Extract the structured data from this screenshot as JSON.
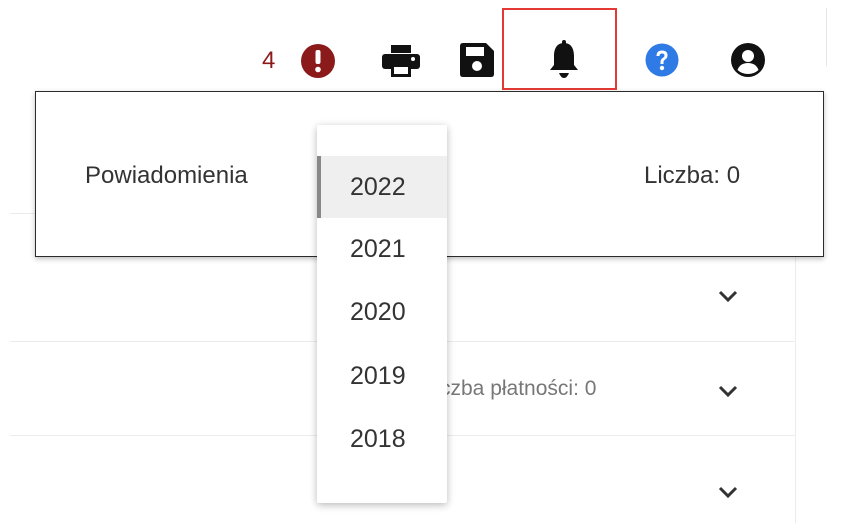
{
  "toolbar": {
    "alert_count": "4",
    "icons": [
      "alert-icon",
      "print-icon",
      "save-icon",
      "bell-icon",
      "help-icon",
      "account-icon"
    ],
    "alert_color": "#8b1a1a",
    "help_color": "#2f7be5"
  },
  "background": {
    "row_label": "czba płatności: 0"
  },
  "notifications": {
    "title": "Powiadomienia",
    "count": "Liczba: 0"
  },
  "year_dropdown": {
    "selected": "2022",
    "options": [
      "2022",
      "2021",
      "2020",
      "2019",
      "2018"
    ]
  }
}
